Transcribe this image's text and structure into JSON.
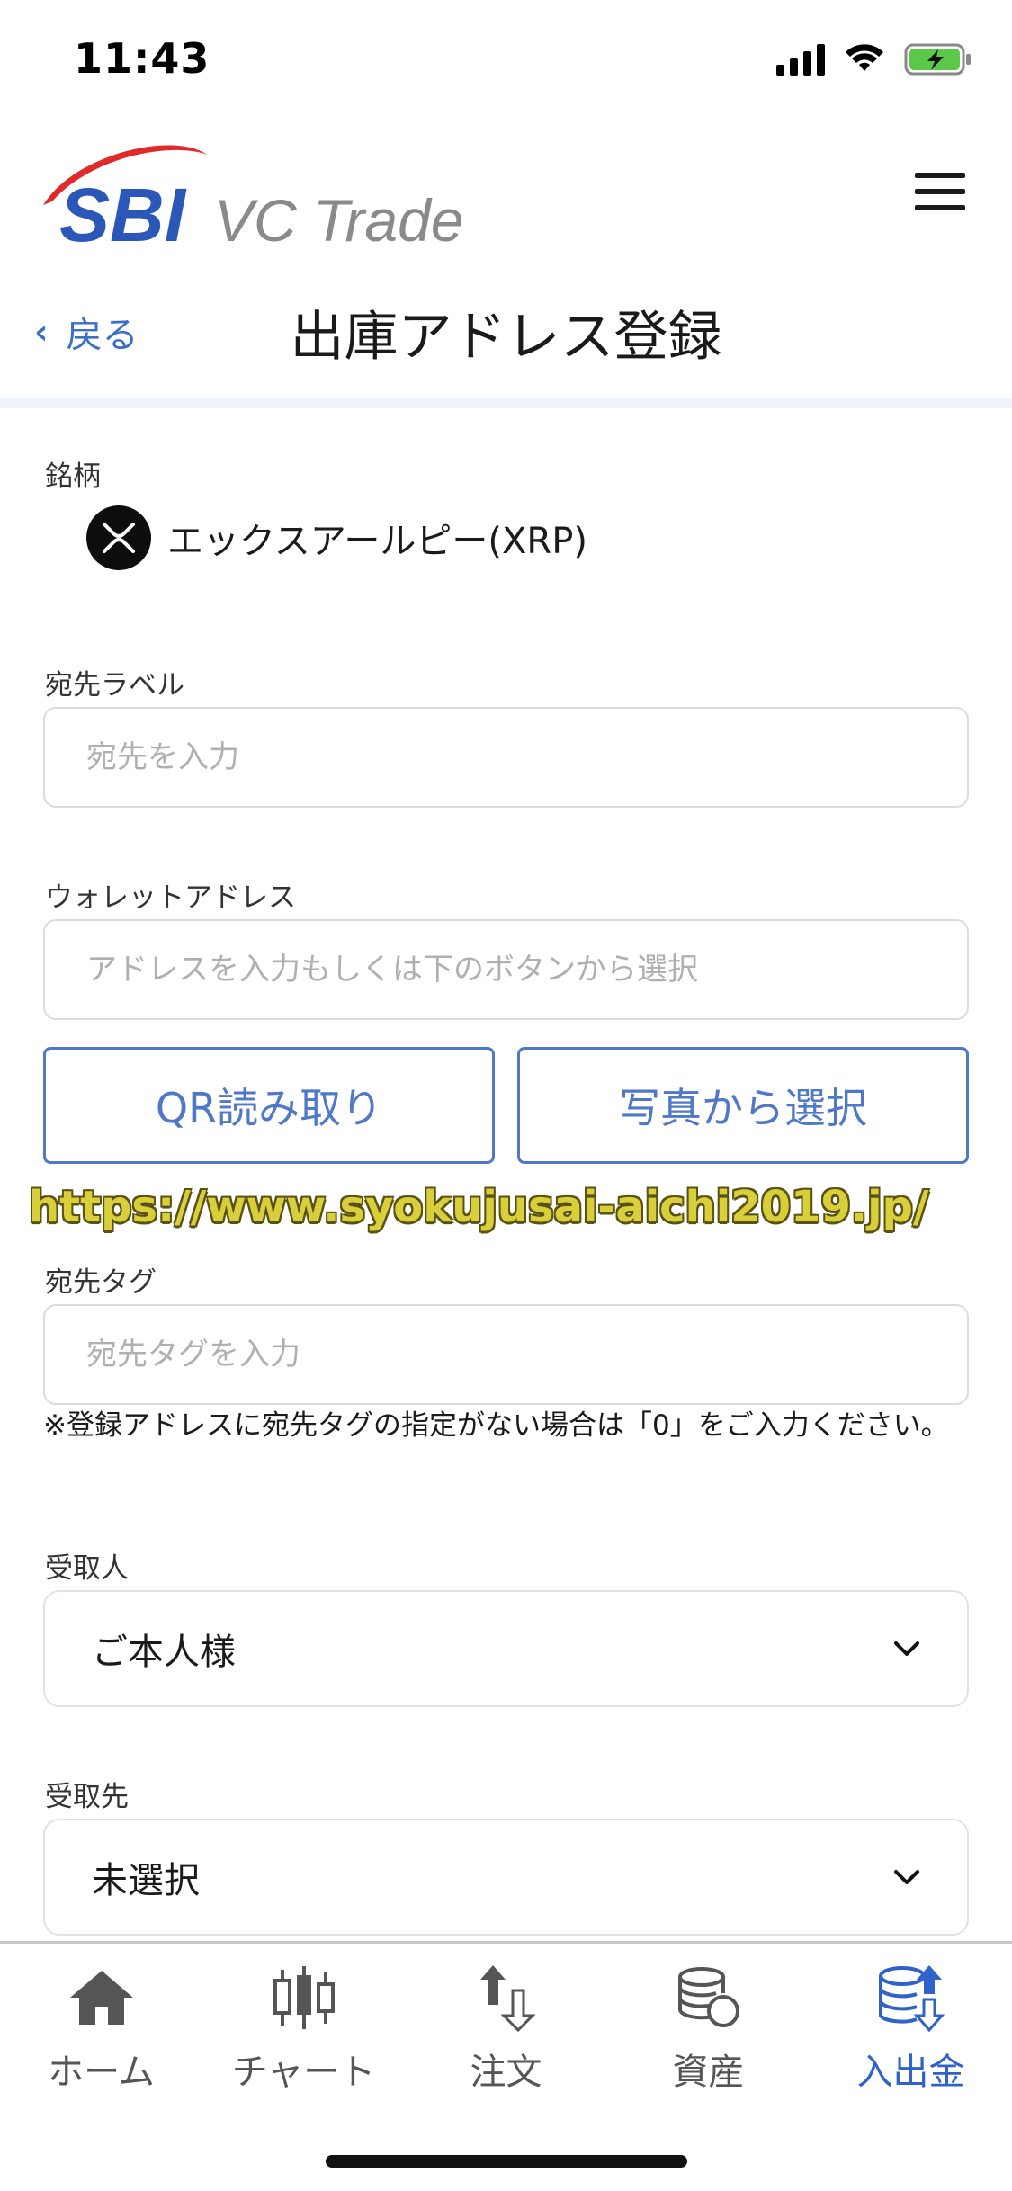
{
  "status_bar": {
    "time": "11:43"
  },
  "header": {
    "logo_sbi": "SBI",
    "logo_vc": "VC Trade",
    "back_label": "戻る",
    "back_chevron": "‹",
    "title": "出庫アドレス登録"
  },
  "form": {
    "coin": {
      "label": "銘柄",
      "name": "エックスアールピー(XRP)"
    },
    "dest_label": {
      "label": "宛先ラベル",
      "placeholder": "宛先を入力"
    },
    "wallet": {
      "label": "ウォレットアドレス",
      "placeholder": "アドレスを入力もしくは下のボタンから選択"
    },
    "buttons": {
      "qr": "QR読み取り",
      "photo": "写真から選択"
    },
    "watermark": "https://www.syokujusai-aichi2019.jp/",
    "tag": {
      "label": "宛先タグ",
      "placeholder": "宛先タグを入力",
      "note": "※登録アドレスに宛先タグの指定がない場合は「0」をご入力ください。"
    },
    "recipient": {
      "label": "受取人",
      "value": "ご本人様"
    },
    "destination": {
      "label": "受取先",
      "value": "未選択"
    }
  },
  "tabs": [
    {
      "label": "ホーム",
      "icon": "home-icon",
      "active": false
    },
    {
      "label": "チャート",
      "icon": "candlestick-chart-icon",
      "active": false
    },
    {
      "label": "注文",
      "icon": "order-arrows-icon",
      "active": false
    },
    {
      "label": "資産",
      "icon": "coins-icon",
      "active": false
    },
    {
      "label": "入出金",
      "icon": "deposit-withdraw-icon",
      "active": true
    }
  ],
  "colors": {
    "accent": "#4f78c9",
    "active_tab": "#2f63c9",
    "logo_red": "#e02a2a",
    "logo_blue": "#2b58b8"
  }
}
